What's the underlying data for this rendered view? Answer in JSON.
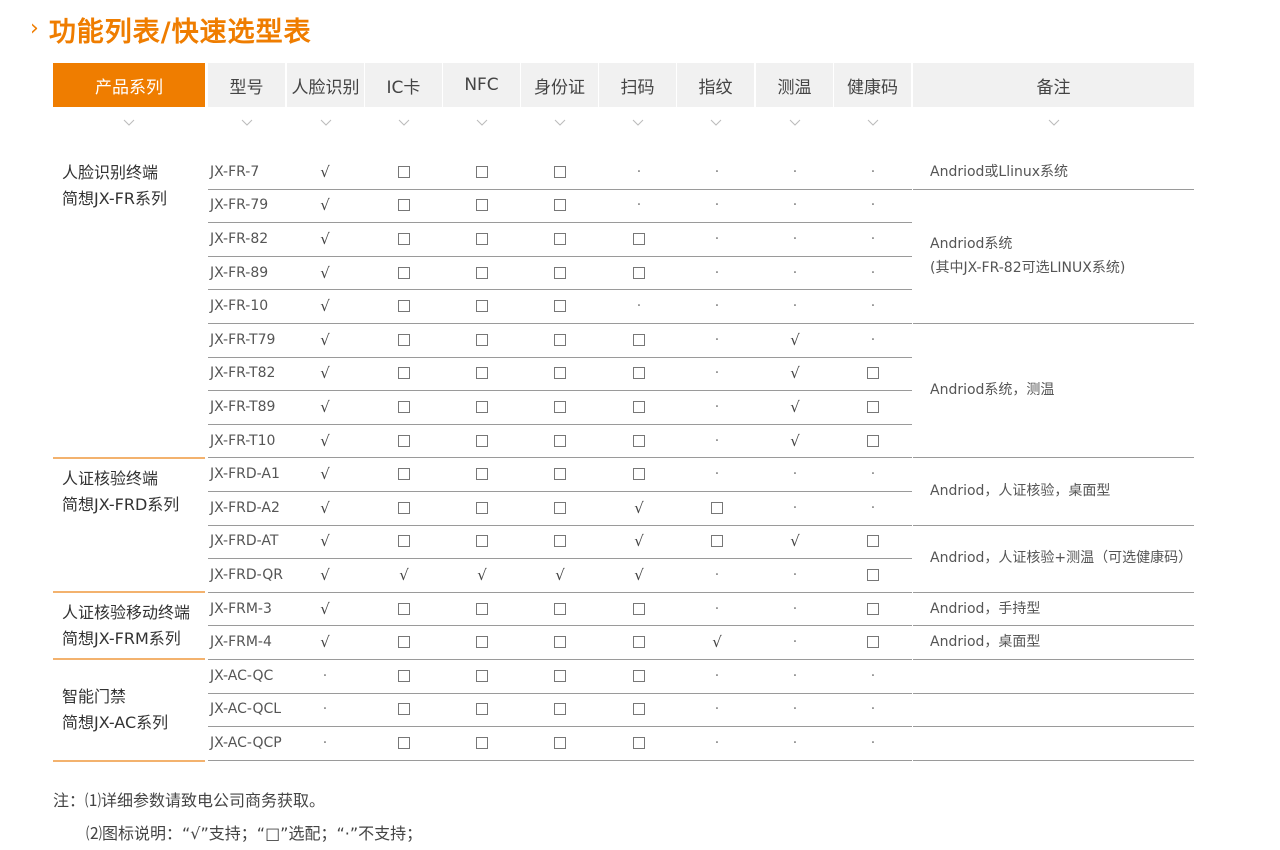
{
  "title": "功能列表/快速选型表",
  "headers": [
    "产品系列",
    "型号",
    "人脸识别",
    "IC卡",
    "NFC",
    "身份证",
    "扫码",
    "指纹",
    "测温",
    "健康码",
    "备注"
  ],
  "legend": {
    "check": "√",
    "box": "□",
    "dot": "·"
  },
  "series": [
    {
      "line1": "人脸识别终端",
      "line2": "简想JX-FR系列"
    },
    {
      "line1": "人证核验终端",
      "line2": "简想JX-FRD系列"
    },
    {
      "line1": "人证核验移动终端",
      "line2": "简想JX-FRM系列"
    },
    {
      "line1": "智能门禁",
      "line2": "简想JX-AC系列"
    }
  ],
  "rows": [
    {
      "model": "JX-FR-7",
      "f": [
        "c",
        "b",
        "b",
        "b",
        "d",
        "d",
        "d",
        "d"
      ]
    },
    {
      "model": "JX-FR-79",
      "f": [
        "c",
        "b",
        "b",
        "b",
        "d",
        "d",
        "d",
        "d"
      ]
    },
    {
      "model": "JX-FR-82",
      "f": [
        "c",
        "b",
        "b",
        "b",
        "b",
        "d",
        "d",
        "d"
      ]
    },
    {
      "model": "JX-FR-89",
      "f": [
        "c",
        "b",
        "b",
        "b",
        "b",
        "d",
        "d",
        "d"
      ]
    },
    {
      "model": "JX-FR-10",
      "f": [
        "c",
        "b",
        "b",
        "b",
        "d",
        "d",
        "d",
        "d"
      ]
    },
    {
      "model": "JX-FR-T79",
      "f": [
        "c",
        "b",
        "b",
        "b",
        "b",
        "d",
        "c",
        "d"
      ]
    },
    {
      "model": "JX-FR-T82",
      "f": [
        "c",
        "b",
        "b",
        "b",
        "b",
        "d",
        "c",
        "b"
      ]
    },
    {
      "model": "JX-FR-T89",
      "f": [
        "c",
        "b",
        "b",
        "b",
        "b",
        "d",
        "c",
        "b"
      ]
    },
    {
      "model": "JX-FR-T10",
      "f": [
        "c",
        "b",
        "b",
        "b",
        "b",
        "d",
        "c",
        "b"
      ]
    },
    {
      "model": "JX-FRD-A1",
      "f": [
        "c",
        "b",
        "b",
        "b",
        "b",
        "d",
        "d",
        "d"
      ]
    },
    {
      "model": "JX-FRD-A2",
      "f": [
        "c",
        "b",
        "b",
        "b",
        "c",
        "b",
        "d",
        "d"
      ]
    },
    {
      "model": "JX-FRD-AT",
      "f": [
        "c",
        "b",
        "b",
        "b",
        "c",
        "b",
        "c",
        "b"
      ]
    },
    {
      "model": "JX-FRD-QR",
      "f": [
        "c",
        "c",
        "c",
        "c",
        "c",
        "d",
        "d",
        "b"
      ]
    },
    {
      "model": "JX-FRM-3",
      "f": [
        "c",
        "b",
        "b",
        "b",
        "b",
        "d",
        "d",
        "b"
      ]
    },
    {
      "model": "JX-FRM-4",
      "f": [
        "c",
        "b",
        "b",
        "b",
        "b",
        "c",
        "d",
        "b"
      ]
    },
    {
      "model": "JX-AC-QC",
      "f": [
        "d",
        "b",
        "b",
        "b",
        "b",
        "d",
        "d",
        "d"
      ]
    },
    {
      "model": "JX-AC-QCL",
      "f": [
        "d",
        "b",
        "b",
        "b",
        "b",
        "d",
        "d",
        "d"
      ]
    },
    {
      "model": "JX-AC-QCP",
      "f": [
        "d",
        "b",
        "b",
        "b",
        "b",
        "d",
        "d",
        "d"
      ]
    }
  ],
  "notes": [
    {
      "lines": [
        "Andriod或Llinux系统"
      ]
    },
    {
      "lines": [
        "Andriod系统",
        "(其中JX-FR-82可选LINUX系统)"
      ]
    },
    {
      "lines": [
        "Andriod系统，测温"
      ]
    },
    {
      "lines": [
        "Andriod，人证核验，桌面型"
      ]
    },
    {
      "lines": [
        "Andriod，人证核验+测温（可选健康码）"
      ]
    },
    {
      "lines": [
        "Andriod，手持型"
      ]
    },
    {
      "lines": [
        "Andriod，桌面型"
      ]
    }
  ],
  "footnotes": {
    "line1": "注：⑴详细参数请致电公司商务获取。",
    "line2": "⑵图标说明：“√”支持；“□”选配；“·”不支持；"
  }
}
